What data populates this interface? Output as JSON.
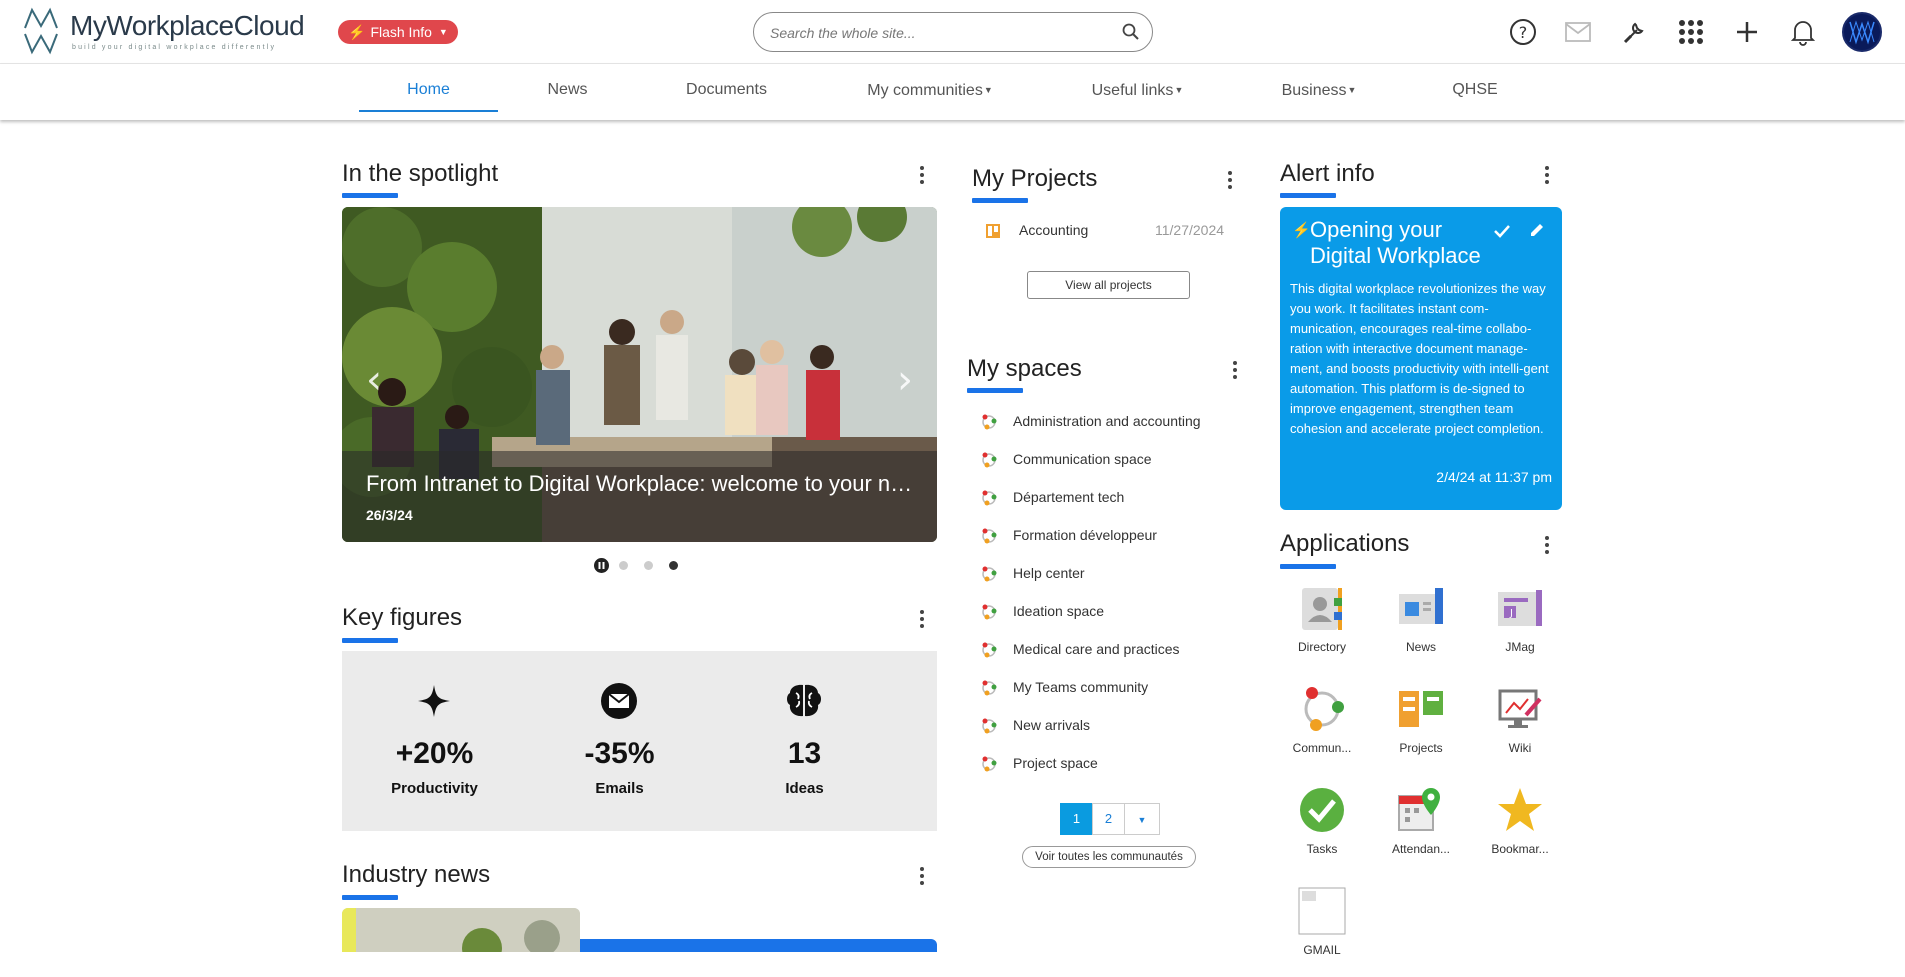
{
  "header": {
    "logo_text": "MyWorkplaceCloud",
    "logo_tagline": "build your digital workplace differently",
    "flash_label": "Flash Info",
    "search_placeholder": "Search the whole site..."
  },
  "nav": {
    "items": [
      {
        "label": "Home",
        "active": true
      },
      {
        "label": "News"
      },
      {
        "label": "Documents"
      },
      {
        "label": "My communities",
        "dropdown": true
      },
      {
        "label": "Useful links",
        "dropdown": true
      },
      {
        "label": "Business",
        "dropdown": true
      },
      {
        "label": "QHSE"
      }
    ]
  },
  "spotlight": {
    "title": "In the spotlight",
    "slide_title": "From Intranet to Digital Workplace: welcome to your new Digital Workplace",
    "slide_date": "26/3/24",
    "slide_count": 4,
    "active_slide": 4
  },
  "key_figures": {
    "title": "Key figures",
    "items": [
      {
        "value": "+20%",
        "label": "Productivity",
        "icon": "sparkle-icon"
      },
      {
        "value": "-35%",
        "label": "Emails",
        "icon": "envelope-icon"
      },
      {
        "value": "13",
        "label": "Ideas",
        "icon": "brain-icon"
      }
    ]
  },
  "industry_news": {
    "title": "Industry news"
  },
  "projects": {
    "title": "My Projects",
    "items": [
      {
        "name": "Accounting",
        "date": "11/27/2024"
      }
    ],
    "view_all": "View all projects"
  },
  "spaces": {
    "title": "My spaces",
    "items": [
      "Administration and accounting",
      "Communication space",
      "Département tech",
      "Formation développeur",
      "Help center",
      "Ideation space",
      "Medical care and practices",
      "My Teams community",
      "New arrivals",
      "Project space"
    ],
    "pages": [
      "1",
      "2"
    ],
    "see_all": "Voir toutes les communautés"
  },
  "alert": {
    "title": "Alert info",
    "card_title": "Opening your Digital Workplace",
    "card_body": "This digital workplace revolutionizes the way you work. It facilitates instant com-munication, encourages real-time collabo-ration with interactive document manage-ment, and boosts productivity with intelli-gent automation. This platform is de-signed to improve engagement, strengthen team cohesion and accelerate project completion.",
    "card_date": "2/4/24 at 11:37 pm",
    "color": "#0a9be8"
  },
  "applications": {
    "title": "Applications",
    "items": [
      {
        "name": "Directory",
        "icon": "directory-icon"
      },
      {
        "name": "News",
        "icon": "news-icon"
      },
      {
        "name": "JMag",
        "icon": "jmag-icon"
      },
      {
        "name": "Commun...",
        "icon": "communities-icon"
      },
      {
        "name": "Projects",
        "icon": "projects-icon"
      },
      {
        "name": "Wiki",
        "icon": "wiki-icon"
      },
      {
        "name": "Tasks",
        "icon": "tasks-icon"
      },
      {
        "name": "Attendan...",
        "icon": "attendance-icon"
      },
      {
        "name": "Bookmar...",
        "icon": "bookmark-icon"
      },
      {
        "name": "GMAIL",
        "icon": "gmail-icon"
      }
    ]
  },
  "colors": {
    "accent": "#1a73e8",
    "flash": "#e0474c",
    "alert": "#0a9be8",
    "active_nav": "#1a7fd6"
  }
}
